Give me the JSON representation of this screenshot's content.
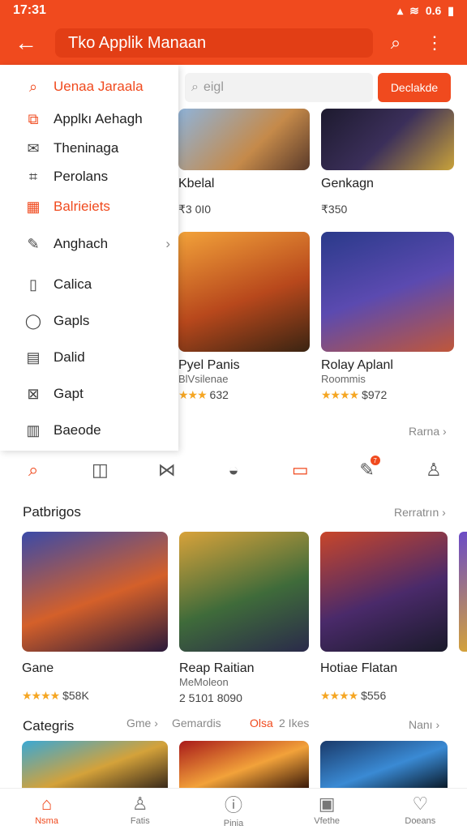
{
  "status": {
    "time": "17:31",
    "right": "0.6"
  },
  "appbar": {
    "title": "Tko Applik Manaan"
  },
  "search": {
    "placeholder": "eigl",
    "button": "Declakde"
  },
  "drawer": {
    "items": [
      {
        "label": "Uenaa Jaraala",
        "icon": "search-icon",
        "accent": true
      },
      {
        "label": "Applkı Aehagh",
        "icon": "apps-icon",
        "accent": false
      },
      {
        "label": "Theninaga",
        "icon": "mail-icon",
        "accent": false
      },
      {
        "label": "Perolans",
        "icon": "chart-icon",
        "accent": false
      },
      {
        "label": "Balrieiets",
        "icon": "grid-icon",
        "accent": true
      },
      {
        "label": "Anghach",
        "icon": "edit-icon",
        "accent": false
      },
      {
        "label": "Calica",
        "icon": "book-icon",
        "accent": false
      },
      {
        "label": "Gapls",
        "icon": "shield-icon",
        "accent": false
      },
      {
        "label": "Dalid",
        "icon": "calendar-icon",
        "accent": false
      },
      {
        "label": "Gapt",
        "icon": "x-box-icon",
        "accent": false
      },
      {
        "label": "Baeode",
        "icon": "barcode-icon",
        "accent": false
      }
    ]
  },
  "topgrid": [
    {
      "title": "Kbelal",
      "sub": "",
      "rating": "₹3 0I0",
      "stars": ""
    },
    {
      "title": "Genkagn",
      "sub": "",
      "rating": "₹350",
      "stars": ""
    },
    {
      "title": "Pyel Panis",
      "sub": "BlVsilenae",
      "rating": "632",
      "stars": "★★★"
    },
    {
      "title": "Rolay Aplanl",
      "sub": "Roommis",
      "rating": "$972",
      "stars": "★★★★"
    }
  ],
  "top_more": "Rarna",
  "tabs": [
    "search-icon",
    "bag-icon",
    "share-icon",
    "shield-icon",
    "tv-icon",
    "edit-icon",
    "user-icon"
  ],
  "tab_badge": "7",
  "section1": {
    "title": "Patbrigos",
    "more": "Rerratrın"
  },
  "section1_cards": [
    {
      "title": "Gane",
      "sub": "",
      "rating": "$58K",
      "stars": "★★★★"
    },
    {
      "title": "Reap Raitian",
      "sub": "MeMoleon",
      "rating": "2 5101 8090",
      "stars": ""
    },
    {
      "title": "Hotiae Flatan",
      "sub": "",
      "rating": "$556",
      "stars": "★★★★"
    }
  ],
  "section2": {
    "title": "Categris",
    "tab1": "Gme",
    "tab2": "Gemardis",
    "tab3": "Olsa",
    "tab4": "2 Ikes",
    "more": "Nanı"
  },
  "bottomnav": [
    {
      "label": "Nsma",
      "icon": "home-icon",
      "active": true
    },
    {
      "label": "Fatis",
      "icon": "user-icon",
      "active": false
    },
    {
      "label": "Pinia",
      "icon": "info-icon",
      "active": false
    },
    {
      "label": "Vfethe",
      "icon": "video-icon",
      "active": false
    },
    {
      "label": "Doeans",
      "icon": "heart-icon",
      "active": false
    }
  ],
  "colors": {
    "accent": "#f04a1e"
  }
}
